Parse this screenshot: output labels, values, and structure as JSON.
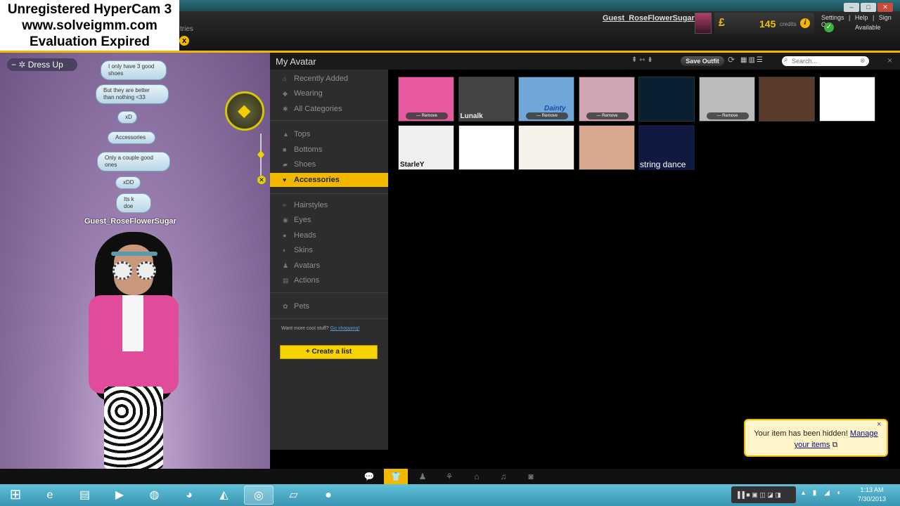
{
  "watermark": {
    "line1": "Unregistered HyperCam 3",
    "line2": "www.solveigmm.com",
    "line3": "Evaluation Expired",
    "close": "x"
  },
  "topbar": {
    "tries_fragment": "tries",
    "username": "Guest_RoseFlowerSugar",
    "credits_icon": "£",
    "credits_value": "145",
    "credits_label": "credits",
    "credits_info": "i",
    "links": [
      "Settings",
      "|",
      "Help",
      "|",
      "Sign Out"
    ],
    "status": "Available",
    "status_check": "✓",
    "window_buttons": [
      "–",
      "□",
      "✕"
    ]
  },
  "scene": {
    "dress_up_label": "Dress Up",
    "collapse": "−",
    "bubbles": [
      "I only have 3 good shoes",
      "But they are better than nothing <33",
      "xD",
      "Accessories",
      "Only a couple good ones",
      "xDD",
      "Its k doe"
    ],
    "avatar_name": "Guest_RoseFlowerSugar",
    "zoom_plus": "+",
    "zoom_minus": "−",
    "close": "✕"
  },
  "panel": {
    "title": "My Avatar",
    "header_icons": "⇞ ⇿ ⇟",
    "save_outfit": "Save Outfit",
    "refresh_icon": "⟳",
    "view_icons": "▦▥☰",
    "search_placeholder": "Search...",
    "search_icon": "⌕",
    "search_clear": "⊗",
    "close": "×"
  },
  "sidebar": {
    "categories": [
      {
        "label": "Recently Added",
        "icon": "⌂"
      },
      {
        "label": "Wearing",
        "icon": "◆"
      },
      {
        "label": "All Categories",
        "icon": "✱"
      },
      {
        "label": "Tops",
        "icon": "▲"
      },
      {
        "label": "Bottoms",
        "icon": "■"
      },
      {
        "label": "Shoes",
        "icon": "▰"
      },
      {
        "label": "Accessories",
        "icon": "♥"
      },
      {
        "label": "Hairstyles",
        "icon": "≈"
      },
      {
        "label": "Eyes",
        "icon": "◉"
      },
      {
        "label": "Heads",
        "icon": "●"
      },
      {
        "label": "Skins",
        "icon": "◐"
      },
      {
        "label": "Avatars",
        "icon": "♟"
      },
      {
        "label": "Actions",
        "icon": "▤"
      },
      {
        "label": "Pets",
        "icon": "✿"
      }
    ],
    "active": "Accessories",
    "more_text": "Want more cool stuff?",
    "more_link": "Go shopping!",
    "create_list_icon": "+",
    "create_list": "Create a list"
  },
  "items": {
    "remove_label": "Remove",
    "tiles": [
      {
        "name": "sunglasses-item",
        "color": "#e85aa0",
        "removable": true,
        "caption": ""
      },
      {
        "name": "key-item",
        "color": "#444444",
        "removable": false,
        "caption": "Lunalk"
      },
      {
        "name": "bracelet-item",
        "color": "#6fa7d8",
        "removable": true,
        "caption": "Dainty"
      },
      {
        "name": "lashes-item",
        "color": "#cfa5b5",
        "removable": true,
        "caption": ""
      },
      {
        "name": "gold-bracelet-item",
        "color": "#0a2030",
        "removable": false,
        "caption": ""
      },
      {
        "name": "heart-necklace-item",
        "color": "#bbbbbb",
        "removable": true,
        "caption": ""
      },
      {
        "name": "flower-necklace-item",
        "color": "#5a3a2a",
        "removable": false,
        "caption": ""
      },
      {
        "name": "mustache-item",
        "color": "#ffffff",
        "removable": false,
        "caption": ""
      },
      {
        "name": "hoop-earring-item",
        "color": "#f0f0f0",
        "removable": false,
        "caption": "StarleY"
      },
      {
        "name": "dance-action-item",
        "color": "#ffffff",
        "removable": false,
        "caption": ""
      },
      {
        "name": "mustache-girl-item",
        "color": "#f5f0e8",
        "removable": false,
        "caption": ""
      },
      {
        "name": "blue-eye-item",
        "color": "#d8a88e",
        "removable": false,
        "caption": ""
      },
      {
        "name": "string-dance-item",
        "color": "#101a40",
        "removable": false,
        "caption": "string dance"
      }
    ]
  },
  "toast": {
    "text": "Your item has been hidden!",
    "link1": "Manage",
    "link2": "your items",
    "close": "×"
  },
  "bottom_nav": [
    {
      "name": "chat-nav",
      "icon": "💬"
    },
    {
      "name": "outfit-nav",
      "icon": "👕"
    },
    {
      "name": "avatar-nav",
      "icon": "♟"
    },
    {
      "name": "poses-nav",
      "icon": "⚘"
    },
    {
      "name": "home-nav",
      "icon": "⌂"
    },
    {
      "name": "music-nav",
      "icon": "♫"
    },
    {
      "name": "camera-nav",
      "icon": "◙"
    }
  ],
  "taskbar": {
    "start": "⊞",
    "apps": [
      {
        "name": "ie-app",
        "icon": "e",
        "open": false
      },
      {
        "name": "explorer-app",
        "icon": "▤",
        "open": false
      },
      {
        "name": "media-app",
        "icon": "▶",
        "open": false
      },
      {
        "name": "chrome-app",
        "icon": "◍",
        "open": false
      },
      {
        "name": "firefox-app",
        "icon": "◕",
        "open": false
      },
      {
        "name": "gimp-app",
        "icon": "◭",
        "open": false
      },
      {
        "name": "imvu-app",
        "icon": "◎",
        "open": true
      },
      {
        "name": "paint-app",
        "icon": "▱",
        "open": false
      },
      {
        "name": "record-app",
        "icon": "●",
        "open": false
      }
    ],
    "recorder": "▐▐ ■ ▣ ◫ ◪ ◨",
    "tray_icons": "▴ ▮ ◢ ◐",
    "time": "1:13 AM",
    "date": "7/30/2013"
  }
}
